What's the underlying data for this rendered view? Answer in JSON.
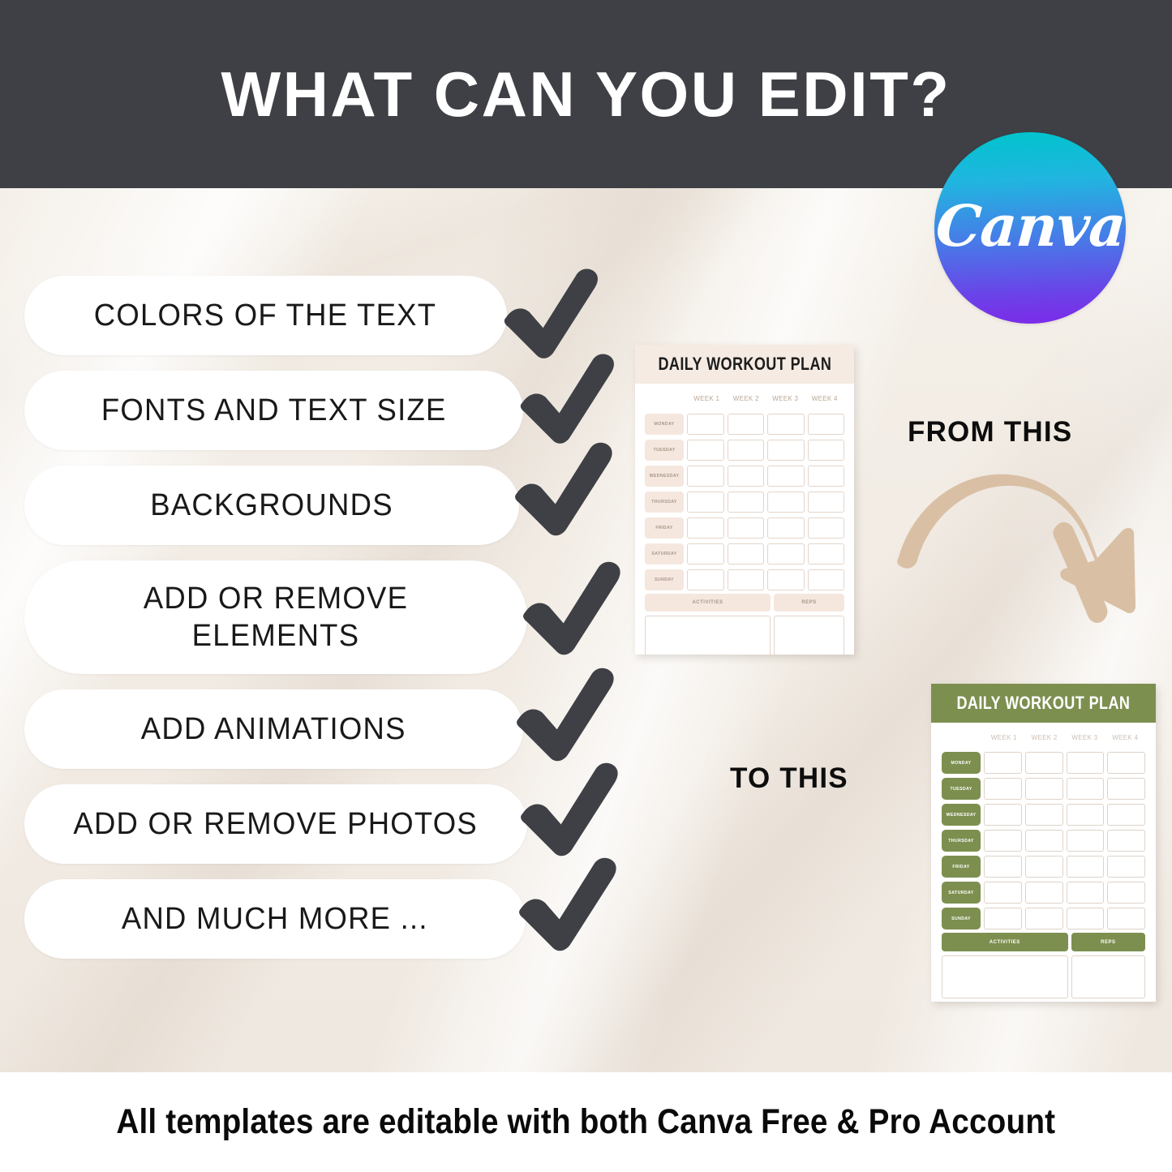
{
  "header": {
    "title": "WHAT CAN YOU EDIT?",
    "background_color": "#3e4045",
    "title_color": "#ffffff"
  },
  "canva_logo": {
    "wordmark": "Canva",
    "gradient_from": "#00c4cc",
    "gradient_to": "#7d2ae8",
    "icon_name": "canva-logo-icon"
  },
  "features": {
    "check_icon_color": "#3e4045",
    "items": [
      {
        "label": "COLORS OF THE TEXT"
      },
      {
        "label": "FONTS AND TEXT SIZE"
      },
      {
        "label": "BACKGROUNDS"
      },
      {
        "label": "ADD OR REMOVE ELEMENTS"
      },
      {
        "label": "ADD ANIMATIONS"
      },
      {
        "label": "ADD OR REMOVE PHOTOS"
      },
      {
        "label": "AND MUCH MORE ..."
      }
    ]
  },
  "callouts": {
    "from_this": "FROM THIS",
    "to_this": "TO THIS",
    "arrow_color": "#d9bfa4",
    "arrow_icon_name": "curved-arrow-icon"
  },
  "planner_beige": {
    "title": "DAILY WORKOUT PLAN",
    "header_color": "#f5ebe3",
    "accent_color": "#f5e7de",
    "week_headers": [
      "WEEK 1",
      "WEEK 2",
      "WEEK 3",
      "WEEK 4"
    ],
    "days": [
      "MONDAY",
      "TUESDAY",
      "WEDNESDAY",
      "THURSDAY",
      "FRIDAY",
      "SATURDAY",
      "SUNDAY"
    ],
    "activities_label": "ACTIVITIES",
    "reps_label": "REPS"
  },
  "planner_green": {
    "title": "DAILY WORKOUT PLAN",
    "header_color": "#7d8f4f",
    "accent_color": "#7d8f4f",
    "week_headers": [
      "WEEK 1",
      "WEEK 2",
      "WEEK 3",
      "WEEK 4"
    ],
    "days": [
      "MONDAY",
      "TUESDAY",
      "WEDNESDAY",
      "THURSDAY",
      "FRIDAY",
      "SATURDAY",
      "SUNDAY"
    ],
    "activities_label": "ACTIVITIES",
    "reps_label": "REPS"
  },
  "footer": {
    "text": "All templates are editable with both Canva Free & Pro Account"
  }
}
